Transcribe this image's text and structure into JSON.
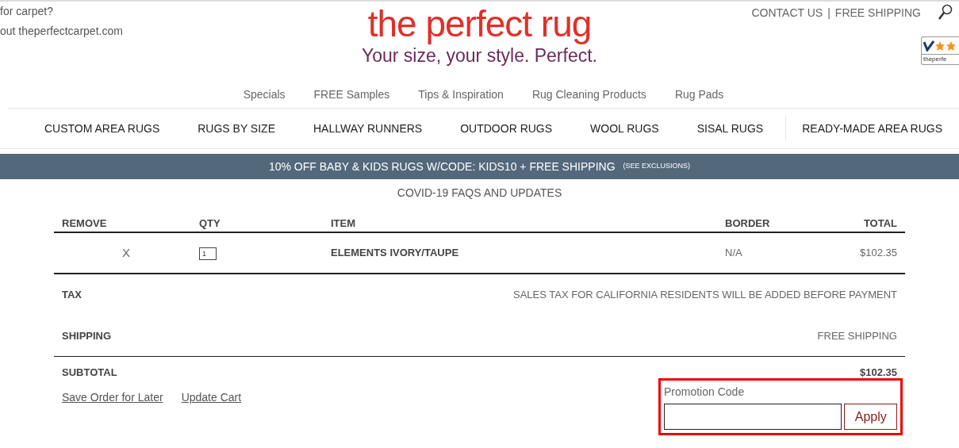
{
  "header": {
    "left_lines": [
      "for carpet?",
      "out theperfectcarpet.com"
    ],
    "logo": "the perfect rug",
    "tagline": "Your size, your style. Perfect.",
    "links": [
      "CONTACT US",
      "FREE SHIPPING"
    ],
    "separator": "|",
    "badge_text": "theperfe"
  },
  "top_nav": [
    "Specials",
    "FREE Samples",
    "Tips & Inspiration",
    "Rug Cleaning Products",
    "Rug Pads"
  ],
  "main_nav": [
    "CUSTOM AREA RUGS",
    "RUGS BY SIZE",
    "HALLWAY RUNNERS",
    "OUTDOOR RUGS",
    "WOOL RUGS",
    "SISAL RUGS",
    "READY-MADE AREA RUGS"
  ],
  "banner": {
    "text": "10% OFF BABY & KIDS RUGS W/CODE: KIDS10 + FREE SHIPPING",
    "link": "(SEE EXCLUSIONS)"
  },
  "covid_link": "COVID-19 FAQS AND UPDATES",
  "cart": {
    "columns": [
      "REMOVE",
      "QTY",
      "ITEM",
      "BORDER",
      "TOTAL"
    ],
    "rows": [
      {
        "remove": "X",
        "qty": "1",
        "item": "ELEMENTS IVORY/TAUPE",
        "border": "N/A",
        "total": "$102.35"
      }
    ],
    "summary": [
      {
        "label": "TAX",
        "value": "SALES TAX FOR CALIFORNIA RESIDENTS WILL BE ADDED BEFORE PAYMENT"
      },
      {
        "label": "SHIPPING",
        "value": "FREE SHIPPING"
      },
      {
        "label": "SUBTOTAL",
        "value": "$102.35"
      }
    ]
  },
  "actions": [
    "Save Order for Later",
    "Update Cart"
  ],
  "promo": {
    "label": "Promotion Code",
    "button": "Apply"
  }
}
